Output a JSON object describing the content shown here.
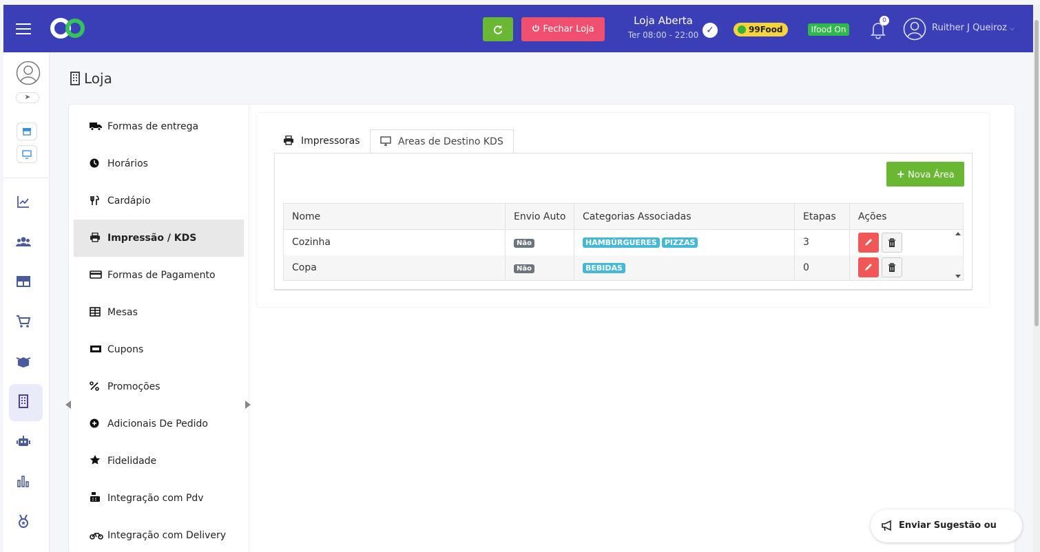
{
  "header": {
    "close_store_label": "Fechar Loja",
    "store_status": "Loja Aberta",
    "store_hours": "Ter 08:00 - 22:00",
    "badge_99food": "99Food",
    "badge_ifood": "Ifood On",
    "notification_count": "0",
    "user_name": "Ruither J Queiroz"
  },
  "page": {
    "title": "Loja"
  },
  "submenu": {
    "items": [
      {
        "label": "Formas de entrega",
        "icon": "truck-icon"
      },
      {
        "label": "Horários",
        "icon": "clock-icon"
      },
      {
        "label": "Cardápio",
        "icon": "utensils-icon"
      },
      {
        "label": "Impressão / KDS",
        "icon": "printer-icon"
      },
      {
        "label": "Formas de Pagamento",
        "icon": "credit-card-icon"
      },
      {
        "label": "Mesas",
        "icon": "table-icon"
      },
      {
        "label": "Cupons",
        "icon": "ticket-icon"
      },
      {
        "label": "Promoções",
        "icon": "percent-icon"
      },
      {
        "label": "Adicionais De Pedido",
        "icon": "plus-circle-icon"
      },
      {
        "label": "Fidelidade",
        "icon": "star-icon"
      },
      {
        "label": "Integração com Pdv",
        "icon": "cash-register-icon"
      },
      {
        "label": "Integração com Delivery",
        "icon": "motorcycle-icon"
      }
    ],
    "active_index": 3
  },
  "tabs": {
    "printers": "Impressoras",
    "kds_areas": "Areas de Destino KDS"
  },
  "kds": {
    "new_area_label": "Nova Área",
    "columns": [
      "Nome",
      "Envio Auto",
      "Categorias Associadas",
      "Etapas",
      "Ações"
    ],
    "rows": [
      {
        "name": "Cozinha",
        "auto_send": "Não",
        "categories": [
          "HAMBÚRGUERES",
          "PIZZAS"
        ],
        "steps": "3"
      },
      {
        "name": "Copa",
        "auto_send": "Não",
        "categories": [
          "BEBIDAS"
        ],
        "steps": "0"
      }
    ]
  },
  "feedback": {
    "label": "Enviar Sugestão ou Erro."
  },
  "colors": {
    "topbar": "#3a3fb8",
    "success": "#6ab734",
    "danger": "#ef5070",
    "info": "#45b8d8"
  }
}
